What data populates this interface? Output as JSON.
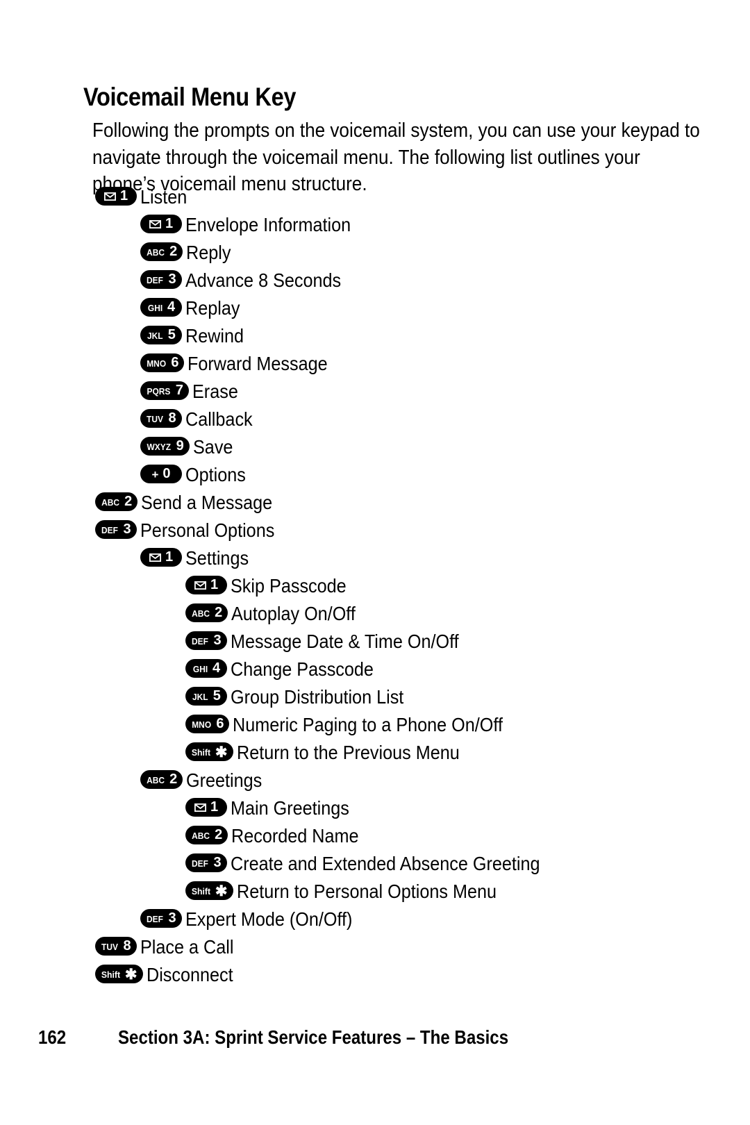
{
  "heading": "Voicemail Menu Key",
  "intro": "Following the prompts on the voicemail system, you can use your keypad to navigate through the voicemail menu. The following list outlines your phone’s voicemail menu structure.",
  "menu": [
    {
      "level": 1,
      "letters": "envelope-icon",
      "digit": "1",
      "label": "Listen"
    },
    {
      "level": 2,
      "letters": "envelope-icon",
      "digit": "1",
      "label": "Envelope Information"
    },
    {
      "level": 2,
      "letters": "ABC",
      "digit": "2",
      "label": "Reply"
    },
    {
      "level": 2,
      "letters": "DEF",
      "digit": "3",
      "label": "Advance 8 Seconds"
    },
    {
      "level": 2,
      "letters": "GHI",
      "digit": "4",
      "label": "Replay"
    },
    {
      "level": 2,
      "letters": "JKL",
      "digit": "5",
      "label": "Rewind"
    },
    {
      "level": 2,
      "letters": "MNO",
      "digit": "6",
      "label": "Forward Message"
    },
    {
      "level": 2,
      "letters": "PQRS",
      "digit": "7",
      "label": "Erase"
    },
    {
      "level": 2,
      "letters": "TUV",
      "digit": "8",
      "label": "Callback"
    },
    {
      "level": 2,
      "letters": "WXYZ",
      "digit": "9",
      "label": "Save"
    },
    {
      "level": 2,
      "letters": "+",
      "digit": "0",
      "label": "Options"
    },
    {
      "level": 1,
      "letters": "ABC",
      "digit": "2",
      "label": "Send a Message"
    },
    {
      "level": 1,
      "letters": "DEF",
      "digit": "3",
      "label": "Personal Options"
    },
    {
      "level": 2,
      "letters": "envelope-icon",
      "digit": "1",
      "label": "Settings"
    },
    {
      "level": 3,
      "letters": "envelope-icon",
      "digit": "1",
      "label": "Skip Passcode"
    },
    {
      "level": 3,
      "letters": "ABC",
      "digit": "2",
      "label": "Autoplay On/Off"
    },
    {
      "level": 3,
      "letters": "DEF",
      "digit": "3",
      "label": "Message Date & Time On/Off"
    },
    {
      "level": 3,
      "letters": "GHI",
      "digit": "4",
      "label": "Change Passcode"
    },
    {
      "level": 3,
      "letters": "JKL",
      "digit": "5",
      "label": "Group Distribution List"
    },
    {
      "level": 3,
      "letters": "MNO",
      "digit": "6",
      "label": "Numeric Paging to a Phone On/Off"
    },
    {
      "level": 3,
      "letters": "Shift",
      "digit": "✱",
      "label": "Return to the Previous Menu"
    },
    {
      "level": 2,
      "letters": "ABC",
      "digit": "2",
      "label": "Greetings"
    },
    {
      "level": 3,
      "letters": "envelope-icon",
      "digit": "1",
      "label": "Main Greetings"
    },
    {
      "level": 3,
      "letters": "ABC",
      "digit": "2",
      "label": "Recorded Name"
    },
    {
      "level": 3,
      "letters": "DEF",
      "digit": "3",
      "label": "Create and Extended Absence Greeting"
    },
    {
      "level": 3,
      "letters": "Shift",
      "digit": "✱",
      "label": "Return to Personal Options Menu"
    },
    {
      "level": 2,
      "letters": "DEF",
      "digit": "3",
      "label": "Expert Mode (On/Off)"
    },
    {
      "level": 1,
      "letters": "TUV",
      "digit": "8",
      "label": "Place a Call"
    },
    {
      "level": 1,
      "letters": "Shift",
      "digit": "✱",
      "label": "Disconnect"
    }
  ],
  "footer": {
    "page_number": "162",
    "section": "Section 3A: Sprint Service Features – The Basics"
  },
  "colors": {
    "key_background": "#000000",
    "key_foreground": "#ffffff",
    "text": "#000000",
    "page_background": "#ffffff"
  }
}
